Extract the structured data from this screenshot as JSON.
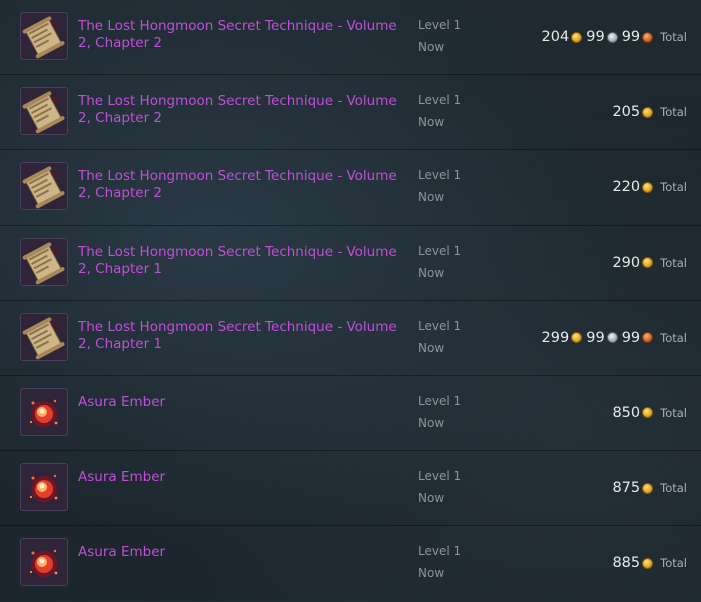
{
  "rows": [
    {
      "name": "The Lost Hongmoon Secret Technique - Volume 2, Chapter 2",
      "icon": "scroll-icon",
      "level": "Level 1",
      "when": "Now",
      "gold": "204",
      "silver": "99",
      "copper": "99",
      "total": "Total"
    },
    {
      "name": "The Lost Hongmoon Secret Technique - Volume 2, Chapter 2",
      "icon": "scroll-icon",
      "level": "Level 1",
      "when": "Now",
      "gold": "205",
      "silver": "",
      "copper": "",
      "total": "Total"
    },
    {
      "name": "The Lost Hongmoon Secret Technique - Volume 2, Chapter 2",
      "icon": "scroll-icon",
      "level": "Level 1",
      "when": "Now",
      "gold": "220",
      "silver": "",
      "copper": "",
      "total": "Total"
    },
    {
      "name": "The Lost Hongmoon Secret Technique - Volume 2, Chapter 1",
      "icon": "scroll-icon",
      "level": "Level 1",
      "when": "Now",
      "gold": "290",
      "silver": "",
      "copper": "",
      "total": "Total"
    },
    {
      "name": "The Lost Hongmoon Secret Technique - Volume 2, Chapter 1",
      "icon": "scroll-icon",
      "level": "Level 1",
      "when": "Now",
      "gold": "299",
      "silver": "99",
      "copper": "99",
      "total": "Total"
    },
    {
      "name": "Asura Ember",
      "icon": "ember-icon",
      "level": "Level 1",
      "when": "Now",
      "gold": "850",
      "silver": "",
      "copper": "",
      "total": "Total"
    },
    {
      "name": "Asura Ember",
      "icon": "ember-icon",
      "level": "Level 1",
      "when": "Now",
      "gold": "875",
      "silver": "",
      "copper": "",
      "total": "Total"
    },
    {
      "name": "Asura Ember",
      "icon": "ember-icon",
      "level": "Level 1",
      "when": "Now",
      "gold": "885",
      "silver": "",
      "copper": "",
      "total": "Total"
    }
  ],
  "colors": {
    "item_name": "#c04ed8",
    "gold": "#d49a1a",
    "silver": "#9aa3aa",
    "copper": "#c4561a"
  }
}
